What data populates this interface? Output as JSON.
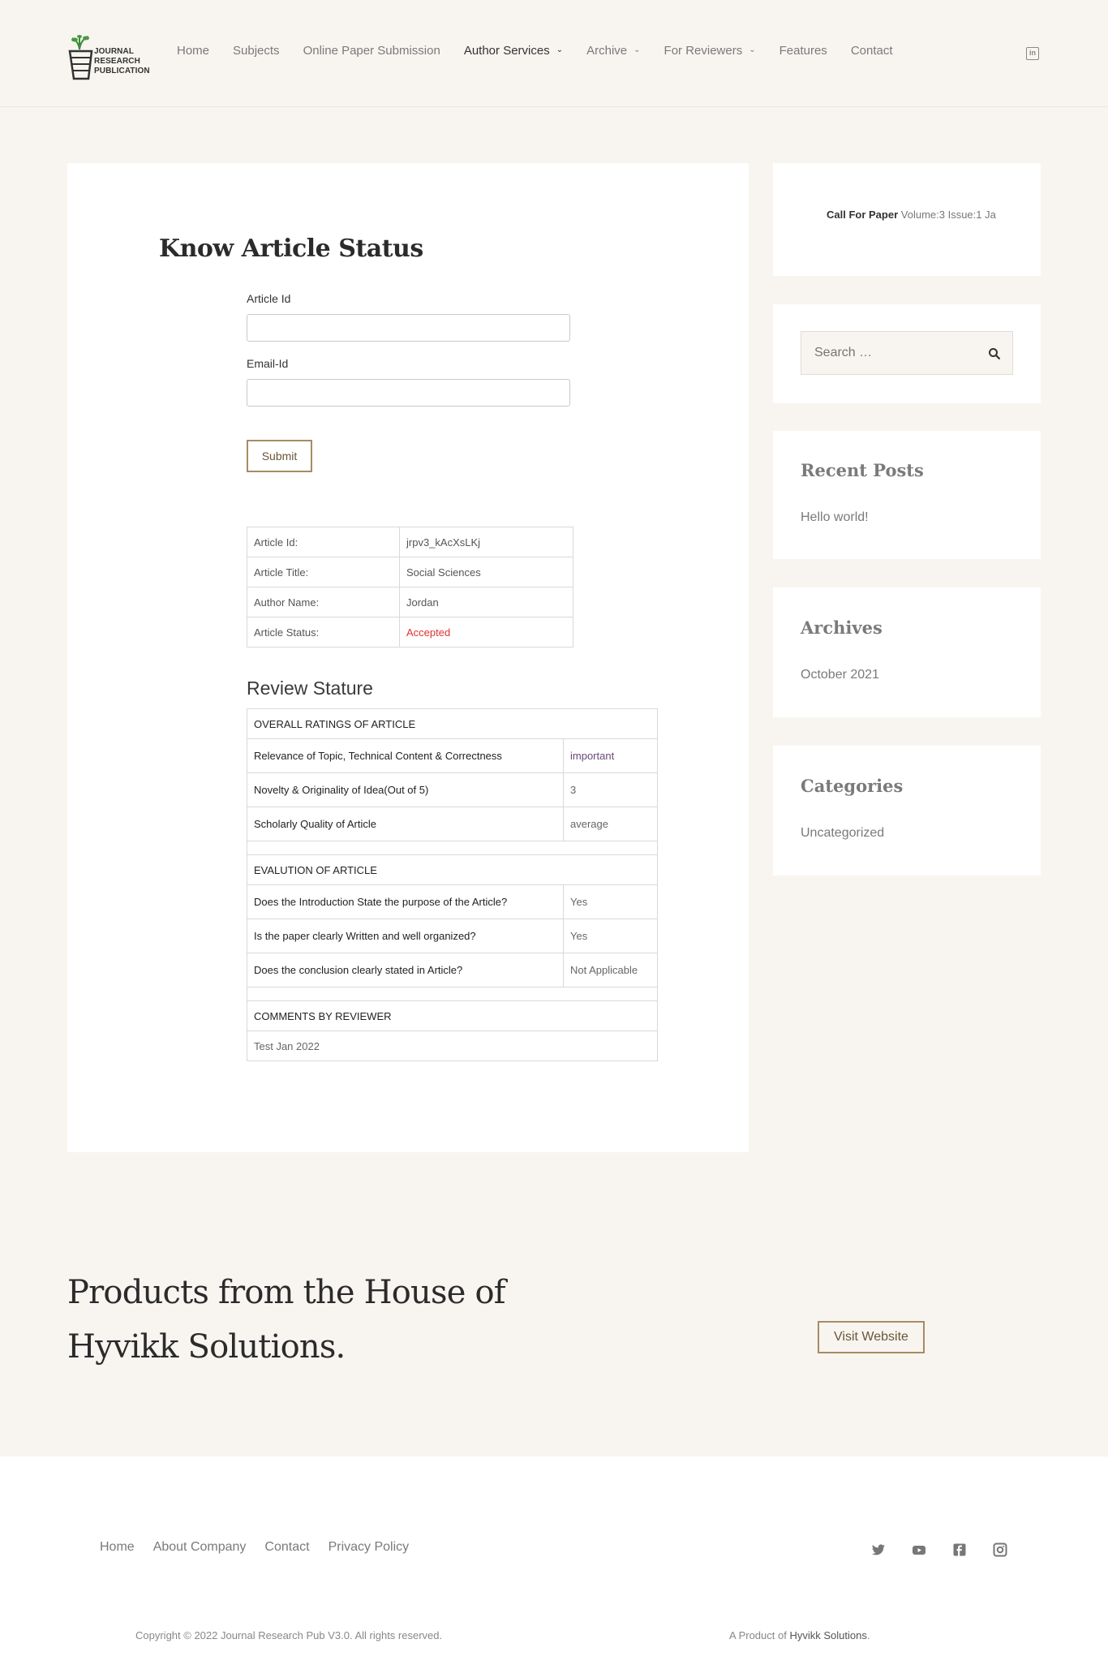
{
  "logo": {
    "line1": "JOURNAL",
    "line2": "RESEARCH",
    "line3": "PUBLICATION"
  },
  "nav": {
    "items": [
      {
        "label": "Home",
        "dropdown": false
      },
      {
        "label": "Subjects",
        "dropdown": false
      },
      {
        "label": "Online Paper Submission",
        "dropdown": false
      },
      {
        "label": "Author Services",
        "dropdown": true,
        "active": true
      },
      {
        "label": "Archive",
        "dropdown": true
      },
      {
        "label": "For Reviewers",
        "dropdown": true
      },
      {
        "label": "Features",
        "dropdown": false
      },
      {
        "label": "Contact",
        "dropdown": false
      }
    ],
    "social_icon": "linkedin-icon"
  },
  "main": {
    "title": "Know Article Status",
    "article_id_label": "Article Id",
    "article_id_value": "",
    "email_label": "Email-Id",
    "email_value": "",
    "submit_label": "Submit",
    "info": [
      {
        "key": "Article Id:",
        "value": "jrpv3_kAcXsLKj"
      },
      {
        "key": "Article Title:",
        "value": "Social Sciences"
      },
      {
        "key": "Author Name:",
        "value": "Jordan"
      },
      {
        "key": "Article Status:",
        "value": "Accepted"
      }
    ],
    "review_heading": "Review Stature",
    "review": {
      "ratings_header": "OVERALL RATINGS OF ARTICLE",
      "ratings": [
        {
          "q": "Relevance of Topic, Technical Content & Correctness",
          "a": "important"
        },
        {
          "q": "Novelty & Originality of Idea(Out of 5)",
          "a": "3"
        },
        {
          "q": "Scholarly Quality of Article",
          "a": "average"
        }
      ],
      "evaluation_header": "EVALUTION OF ARTICLE",
      "evaluation": [
        {
          "q": "Does the Introduction State the purpose of the Article?",
          "a": "Yes"
        },
        {
          "q": "Is the paper clearly Written and well organized?",
          "a": "Yes"
        },
        {
          "q": "Does the conclusion clearly stated in Article?",
          "a": "Not Applicable"
        }
      ],
      "comments_header": "COMMENTS BY REVIEWER",
      "comment": "Test Jan 2022"
    }
  },
  "sidebar": {
    "call_for_paper_bold": "Call For Paper",
    "call_for_paper_text": "Volume:3 Issue:1 Ja",
    "search_placeholder": "Search …",
    "recent_posts_title": "Recent Posts",
    "recent_posts": [
      "Hello world!"
    ],
    "archives_title": "Archives",
    "archives": [
      "October 2021"
    ],
    "categories_title": "Categories",
    "categories": [
      "Uncategorized"
    ]
  },
  "cta": {
    "line1": "Products from the House of",
    "line2": "Hyvikk Solutions.",
    "button": "Visit Website"
  },
  "footer": {
    "nav": [
      "Home",
      "About Company",
      "Contact",
      "Privacy Policy"
    ],
    "social_icons": [
      "twitter-icon",
      "youtube-icon",
      "facebook-icon",
      "instagram-icon"
    ],
    "copyright": "Copyright © 2022 Journal Research Pub V3.0. All rights reserved.",
    "product_prefix": "A Product of",
    "product_name": "Hyvikk Solutions",
    "product_suffix": "."
  },
  "colors": {
    "accent": "#a88b63",
    "background": "#f8f5f1",
    "status_accepted": "#dd3333"
  }
}
